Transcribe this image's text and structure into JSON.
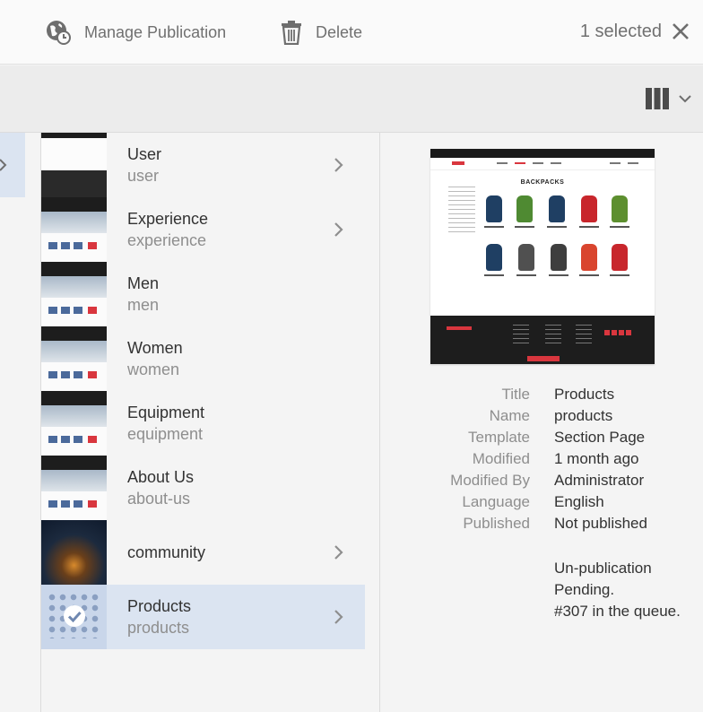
{
  "actionbar": {
    "manage_publication": "Manage Publication",
    "delete": "Delete",
    "selected_count": "1 selected"
  },
  "icons": {
    "manage": "globe-clock-icon",
    "delete": "trash-icon",
    "close": "close-icon",
    "view": "column-view-icon",
    "view_menu": "chevron-down-icon",
    "row_arrow": "chevron-right-icon",
    "selected_mark": "checkmark-circle-icon"
  },
  "colors": {
    "selection": "#dbe4f1",
    "accent_red": "#d9363e"
  },
  "pages": [
    {
      "title": "User",
      "name": "user",
      "thumb": "user",
      "has_children": true,
      "selected": false
    },
    {
      "title": "Experience",
      "name": "experience",
      "thumb": "hero",
      "has_children": true,
      "selected": false
    },
    {
      "title": "Men",
      "name": "men",
      "thumb": "hero",
      "has_children": false,
      "selected": false
    },
    {
      "title": "Women",
      "name": "women",
      "thumb": "hero",
      "has_children": false,
      "selected": false
    },
    {
      "title": "Equipment",
      "name": "equipment",
      "thumb": "hero",
      "has_children": false,
      "selected": false
    },
    {
      "title": "About Us",
      "name": "about-us",
      "thumb": "hero",
      "has_children": false,
      "selected": false
    },
    {
      "title": "community",
      "name": "",
      "thumb": "community",
      "has_children": true,
      "selected": false
    },
    {
      "title": "Products",
      "name": "products",
      "thumb": "products",
      "has_children": true,
      "selected": true
    }
  ],
  "details": {
    "preview_heading": "BACKPACKS",
    "properties": [
      {
        "key": "Title",
        "value": "Products"
      },
      {
        "key": "Name",
        "value": "products"
      },
      {
        "key": "Template",
        "value": "Section Page"
      },
      {
        "key": "Modified",
        "value": "1 month ago"
      },
      {
        "key": "Modified By",
        "value": "Administrator"
      },
      {
        "key": "Language",
        "value": "English"
      },
      {
        "key": "Published",
        "value": "Not published"
      }
    ],
    "note_lines": [
      "Un-publication",
      "Pending.",
      "#307 in the queue."
    ]
  }
}
